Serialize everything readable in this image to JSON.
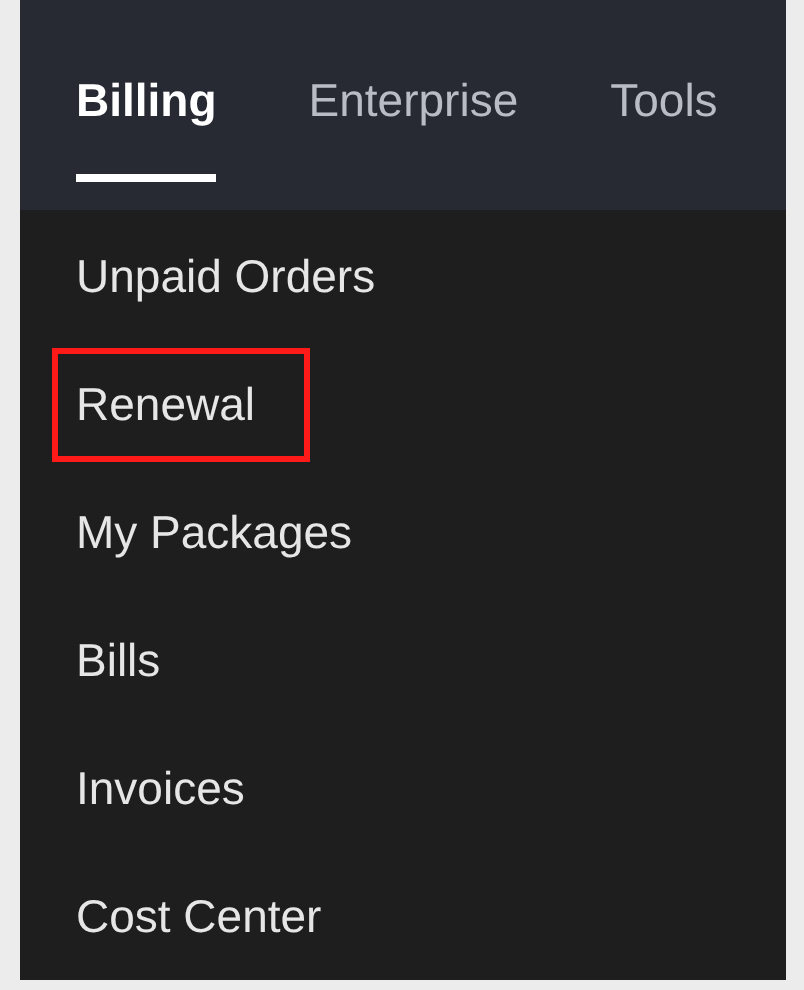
{
  "tabs": [
    {
      "label": "Billing",
      "selected": true
    },
    {
      "label": "Enterprise",
      "selected": false
    },
    {
      "label": "Tools",
      "selected": false
    }
  ],
  "menu": {
    "items": [
      {
        "label": "Unpaid Orders",
        "highlighted": false
      },
      {
        "label": "Renewal",
        "highlighted": true
      },
      {
        "label": "My Packages",
        "highlighted": false
      },
      {
        "label": "Bills",
        "highlighted": false
      },
      {
        "label": "Invoices",
        "highlighted": false
      },
      {
        "label": "Cost Center",
        "highlighted": false
      }
    ]
  }
}
